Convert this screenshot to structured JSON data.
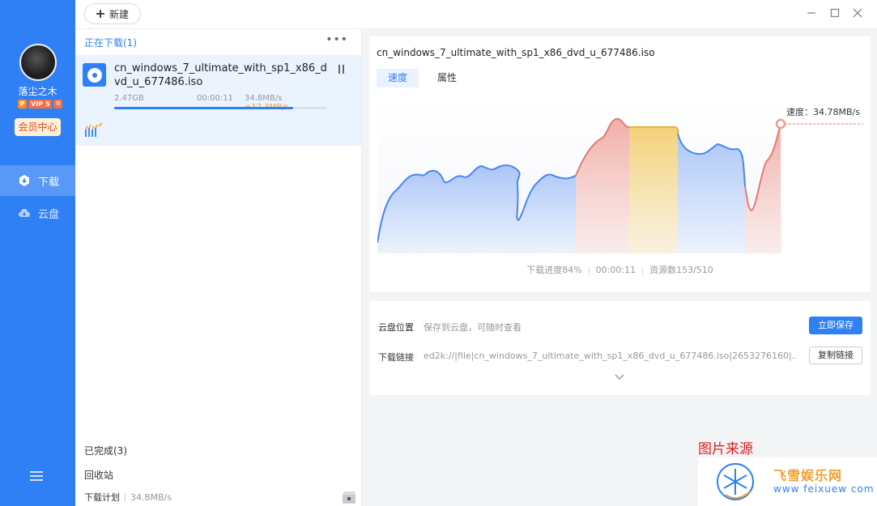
{
  "sidebar": {
    "username": "落尘之木",
    "vip_p": "P",
    "vip_level": "VIP 5",
    "vip_year": "年",
    "member_center": "会员中心",
    "nav": [
      {
        "label": "下载",
        "icon": "download-icon",
        "active": true
      },
      {
        "label": "云盘",
        "icon": "cloud-icon",
        "active": false
      }
    ]
  },
  "toolbar": {
    "new_label": "新建"
  },
  "list": {
    "downloading_title": "正在下载(1)",
    "more": "•••",
    "task": {
      "name": "cn_windows_7_ultimate_with_sp1_x86_dvd_u_677486.iso",
      "size": "2.47GB",
      "time": "00:00:11",
      "speed": "34.8MB/s",
      "boost": "+12.3MB/s",
      "progress": 0.84
    },
    "completed": "已完成(3)",
    "recycle": "回收站",
    "plan_label": "下载计划",
    "plan_speed": "34.8MB/s"
  },
  "detail": {
    "title": "cn_windows_7_ultimate_with_sp1_x86_dvd_u_677486.iso",
    "tabs": [
      "速度",
      "属性"
    ],
    "speed_label": "速度：34.78MB/s",
    "stats": {
      "progress": "下载进度84%",
      "time": "00:00:11",
      "sources": "资源数153/510"
    },
    "cloud_label": "云盘位置",
    "cloud_hint": "保存到云盘，可随时查看",
    "save_now": "立即保存",
    "link_label": "下载链接",
    "link_value": "ed2k://|file|cn_windows_7_ultimate_with_sp1_x86_dvd_u_677486.iso|2653276160|...",
    "copy_link": "复制链接"
  },
  "watermark": {
    "title": "图片来源",
    "site_cn": "飞雪娱乐网",
    "site_url": "www feixuew com"
  },
  "colors": {
    "accent": "#2f80f5",
    "boost": "#f5a623",
    "chart_blue": "#4a86f0",
    "chart_red": "#e57b73",
    "chart_yellow": "#f1c24d"
  }
}
